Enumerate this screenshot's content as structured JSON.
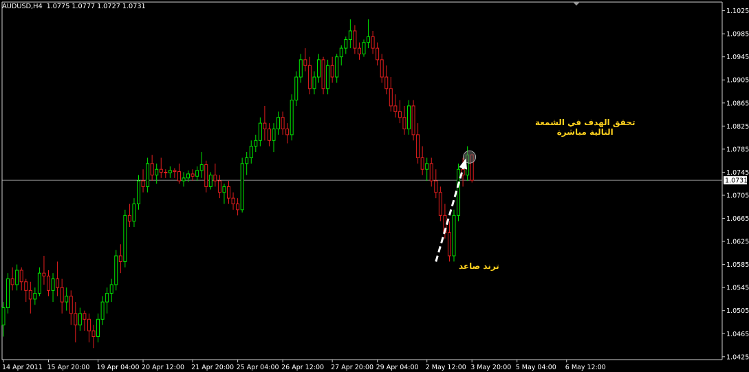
{
  "header": {
    "symbol": "AUDUSD,H4",
    "ohlc": "1.0775 1.0777 1.0727 1.0731"
  },
  "annotations": {
    "target_line1": "تحقق الهدف في الشمعة",
    "target_line2": "التالية مباشرة",
    "trend": "ترند صاعد"
  },
  "colors": {
    "background": "#000000",
    "bull": "#00e600",
    "bear": "#e61e1e",
    "grid": "#c0c0c0",
    "annotation": "#ffd21f",
    "arrow": "#ffffff",
    "price_box_bg": "#ffffff"
  },
  "chart_data": {
    "type": "candlestick",
    "symbol": "AUDUSD",
    "timeframe": "H4",
    "current_price": 1.0731,
    "ylim": [
      1.042,
      1.104
    ],
    "y_ticks": [
      1.1025,
      1.0985,
      1.0945,
      1.0905,
      1.0865,
      1.0825,
      1.0785,
      1.0745,
      1.0705,
      1.0665,
      1.0625,
      1.0585,
      1.0545,
      1.0505,
      1.0465,
      1.0425
    ],
    "x_ticks": [
      {
        "label": "14 Apr 2011",
        "bar": 0
      },
      {
        "label": "15 Apr 20:00",
        "bar": 10
      },
      {
        "label": "19 Apr 04:00",
        "bar": 21
      },
      {
        "label": "20 Apr 12:00",
        "bar": 31
      },
      {
        "label": "21 Apr 20:00",
        "bar": 42
      },
      {
        "label": "25 Apr 04:00",
        "bar": 52
      },
      {
        "label": "26 Apr 12:00",
        "bar": 62
      },
      {
        "label": "27 Apr 20:00",
        "bar": 73
      },
      {
        "label": "29 Apr 04:00",
        "bar": 83
      },
      {
        "label": "2 May 12:00",
        "bar": 94
      },
      {
        "label": "3 May 20:00",
        "bar": 104
      },
      {
        "label": "5 May 04:00",
        "bar": 114
      },
      {
        "label": "6 May 12:00",
        "bar": 125
      }
    ],
    "candles": [
      [
        1.048,
        1.052,
        1.046,
        1.051
      ],
      [
        1.051,
        1.057,
        1.05,
        1.056
      ],
      [
        1.056,
        1.058,
        1.054,
        1.055
      ],
      [
        1.055,
        1.0585,
        1.054,
        1.0575
      ],
      [
        1.0575,
        1.058,
        1.054,
        1.0555
      ],
      [
        1.0555,
        1.056,
        1.052,
        1.054
      ],
      [
        1.054,
        1.0555,
        1.05,
        1.0525
      ],
      [
        1.0525,
        1.0545,
        1.0515,
        1.0535
      ],
      [
        1.0535,
        1.058,
        1.053,
        1.057
      ],
      [
        1.057,
        1.06,
        1.055,
        1.0565
      ],
      [
        1.0565,
        1.0575,
        1.053,
        1.054
      ],
      [
        1.054,
        1.057,
        1.052,
        1.056
      ],
      [
        1.056,
        1.059,
        1.053,
        1.0545
      ],
      [
        1.0545,
        1.056,
        1.05,
        1.052
      ],
      [
        1.052,
        1.0545,
        1.0505,
        1.053
      ],
      [
        1.053,
        1.054,
        1.048,
        1.05
      ],
      [
        1.05,
        1.052,
        1.045,
        1.048
      ],
      [
        1.048,
        1.051,
        1.047,
        1.05
      ],
      [
        1.05,
        1.0505,
        1.047,
        1.049
      ],
      [
        1.049,
        1.05,
        1.045,
        1.047
      ],
      [
        1.047,
        1.048,
        1.044,
        1.046
      ],
      [
        1.046,
        1.05,
        1.045,
        1.049
      ],
      [
        1.049,
        1.053,
        1.048,
        1.052
      ],
      [
        1.052,
        1.0545,
        1.05,
        1.0535
      ],
      [
        1.0535,
        1.056,
        1.052,
        1.055
      ],
      [
        1.055,
        1.061,
        1.054,
        1.06
      ],
      [
        1.06,
        1.062,
        1.057,
        1.059
      ],
      [
        1.059,
        1.068,
        1.058,
        1.067
      ],
      [
        1.067,
        1.069,
        1.065,
        1.066
      ],
      [
        1.066,
        1.07,
        1.065,
        1.069
      ],
      [
        1.069,
        1.074,
        1.068,
        1.073
      ],
      [
        1.073,
        1.075,
        1.071,
        1.072
      ],
      [
        1.072,
        1.077,
        1.071,
        1.076
      ],
      [
        1.076,
        1.0775,
        1.073,
        1.074
      ],
      [
        1.074,
        1.076,
        1.0725,
        1.075
      ],
      [
        1.075,
        1.077,
        1.0735,
        1.0745
      ],
      [
        1.0745,
        1.075,
        1.0735,
        1.0744
      ],
      [
        1.0744,
        1.0755,
        1.0735,
        1.0748
      ],
      [
        1.0748,
        1.0752,
        1.0735,
        1.0746
      ],
      [
        1.0746,
        1.076,
        1.0725,
        1.073
      ],
      [
        1.073,
        1.0745,
        1.072,
        1.0735
      ],
      [
        1.0735,
        1.0748,
        1.0728,
        1.0742
      ],
      [
        1.0742,
        1.075,
        1.073,
        1.0738
      ],
      [
        1.0738,
        1.0755,
        1.073,
        1.0748
      ],
      [
        1.0748,
        1.078,
        1.0735,
        1.0758
      ],
      [
        1.0758,
        1.0765,
        1.071,
        1.072
      ],
      [
        1.072,
        1.0745,
        1.0715,
        1.074
      ],
      [
        1.074,
        1.076,
        1.072,
        1.073
      ],
      [
        1.073,
        1.074,
        1.07,
        1.071
      ],
      [
        1.071,
        1.0725,
        1.069,
        1.072
      ],
      [
        1.072,
        1.073,
        1.069,
        1.07
      ],
      [
        1.07,
        1.071,
        1.068,
        1.069
      ],
      [
        1.069,
        1.07,
        1.067,
        1.068
      ],
      [
        1.068,
        1.077,
        1.0675,
        1.076
      ],
      [
        1.076,
        1.078,
        1.074,
        1.077
      ],
      [
        1.077,
        1.08,
        1.076,
        1.079
      ],
      [
        1.079,
        1.081,
        1.078,
        1.08
      ],
      [
        1.08,
        1.084,
        1.079,
        1.083
      ],
      [
        1.083,
        1.086,
        1.08,
        1.082
      ],
      [
        1.082,
        1.083,
        1.079,
        1.08
      ],
      [
        1.08,
        1.083,
        1.078,
        1.082
      ],
      [
        1.082,
        1.085,
        1.081,
        1.084
      ],
      [
        1.084,
        1.085,
        1.081,
        1.082
      ],
      [
        1.082,
        1.083,
        1.0795,
        1.081
      ],
      [
        1.081,
        1.088,
        1.08,
        1.087
      ],
      [
        1.087,
        1.092,
        1.086,
        1.091
      ],
      [
        1.091,
        1.095,
        1.09,
        1.094
      ],
      [
        1.094,
        1.096,
        1.092,
        1.093
      ],
      [
        1.093,
        1.0945,
        1.088,
        1.089
      ],
      [
        1.089,
        1.092,
        1.088,
        1.091
      ],
      [
        1.091,
        1.095,
        1.09,
        1.094
      ],
      [
        1.094,
        1.0945,
        1.088,
        1.089
      ],
      [
        1.089,
        1.094,
        1.088,
        1.093
      ],
      [
        1.093,
        1.0945,
        1.09,
        1.091
      ],
      [
        1.091,
        1.095,
        1.09,
        1.0945
      ],
      [
        1.0945,
        1.0965,
        1.093,
        1.096
      ],
      [
        1.096,
        1.098,
        1.095,
        1.0975
      ],
      [
        1.0975,
        1.101,
        1.096,
        1.099
      ],
      [
        1.099,
        1.1,
        1.095,
        1.096
      ],
      [
        1.096,
        1.097,
        1.094,
        1.095
      ],
      [
        1.095,
        1.0975,
        1.0945,
        1.097
      ],
      [
        1.097,
        1.101,
        1.096,
        1.098
      ],
      [
        1.098,
        1.099,
        1.095,
        1.096
      ],
      [
        1.096,
        1.097,
        1.093,
        1.094
      ],
      [
        1.094,
        1.095,
        1.09,
        1.091
      ],
      [
        1.091,
        1.093,
        1.088,
        1.089
      ],
      [
        1.089,
        1.091,
        1.085,
        1.086
      ],
      [
        1.086,
        1.088,
        1.084,
        1.085
      ],
      [
        1.085,
        1.087,
        1.083,
        1.084
      ],
      [
        1.084,
        1.086,
        1.081,
        1.082
      ],
      [
        1.082,
        1.087,
        1.081,
        1.086
      ],
      [
        1.086,
        1.087,
        1.08,
        1.081
      ],
      [
        1.081,
        1.083,
        1.076,
        1.077
      ],
      [
        1.077,
        1.079,
        1.074,
        1.075
      ],
      [
        1.075,
        1.077,
        1.073,
        1.076
      ],
      [
        1.076,
        1.077,
        1.072,
        1.073
      ],
      [
        1.073,
        1.075,
        1.07,
        1.071
      ],
      [
        1.071,
        1.072,
        1.066,
        1.067
      ],
      [
        1.067,
        1.069,
        1.063,
        1.064
      ],
      [
        1.064,
        1.066,
        1.059,
        1.06
      ],
      [
        1.06,
        1.068,
        1.059,
        1.067
      ],
      [
        1.067,
        1.076,
        1.066,
        1.075
      ],
      [
        1.075,
        1.077,
        1.072,
        1.074
      ],
      [
        1.074,
        1.079,
        1.073,
        1.0775
      ],
      [
        1.0775,
        1.0777,
        1.0727,
        1.0731
      ]
    ]
  }
}
